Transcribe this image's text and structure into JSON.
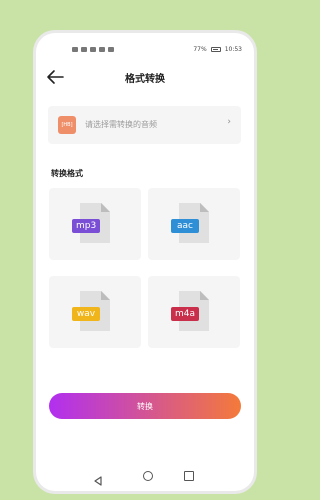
{
  "status_bar": {
    "battery": "77%",
    "time": "10:53"
  },
  "header": {
    "title": "格式转换",
    "back_icon": "arrow-left-icon"
  },
  "audio_selector": {
    "icon_label": "[HB]",
    "placeholder": "请选择需转换的音频",
    "chevron": "›"
  },
  "section": {
    "label": "转换格式"
  },
  "formats": [
    {
      "label": "mp3",
      "color": "#7a4fd6"
    },
    {
      "label": "aac",
      "color": "#2f8fd6"
    },
    {
      "label": "wav",
      "color": "#f1b51c"
    },
    {
      "label": "m4a",
      "color": "#c92e4b"
    }
  ],
  "convert_button": {
    "label": "转换",
    "gradient_start": "#b12ff0",
    "gradient_end": "#f47a3a"
  },
  "nav_bar": {
    "back_icon": "triangle-back-icon",
    "home_icon": "circle-home-icon",
    "recent_icon": "square-recent-icon"
  }
}
